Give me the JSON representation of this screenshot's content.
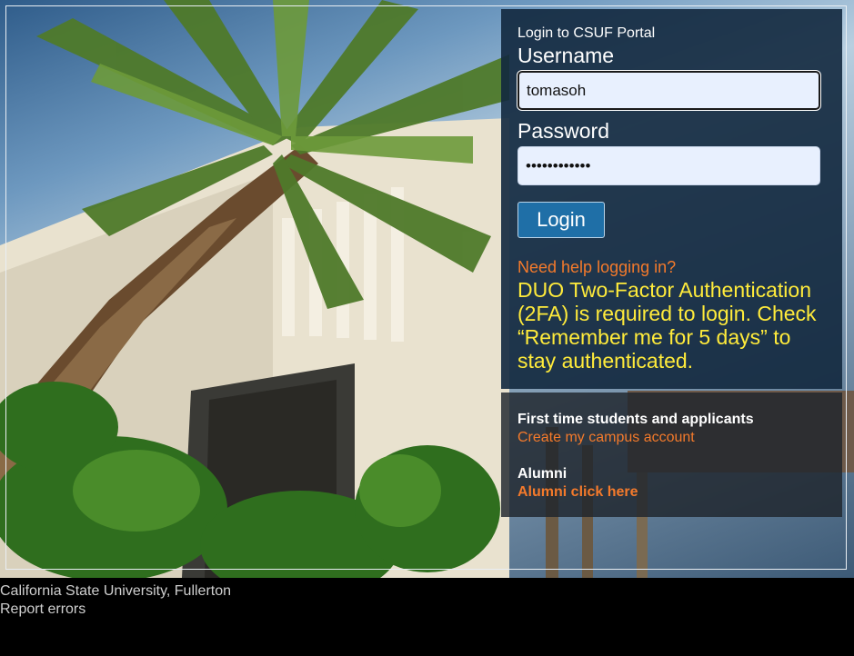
{
  "login": {
    "heading": "Login to CSUF Portal",
    "username_label": "Username",
    "username_value": "tomasoh",
    "password_label": "Password",
    "password_value": "••••••••••••",
    "login_button": "Login",
    "help_link": "Need help logging in?",
    "duo_notice": "DUO Two-Factor Authentication (2FA) is required to login. Check “Remember me for 5 days” to stay authenticated."
  },
  "secondary": {
    "first_time_heading": "First time students and applicants",
    "create_account_link": "Create my campus account",
    "alumni_heading": "Alumni",
    "alumni_link": "Alumni click here"
  },
  "footer": {
    "university": "California State University, Fullerton",
    "report_errors": "Report errors"
  },
  "colors": {
    "panel_bg": "#12283e",
    "link_orange": "#f47a2b",
    "notice_yellow": "#ffeb3b",
    "button_blue": "#1f6fa7"
  }
}
